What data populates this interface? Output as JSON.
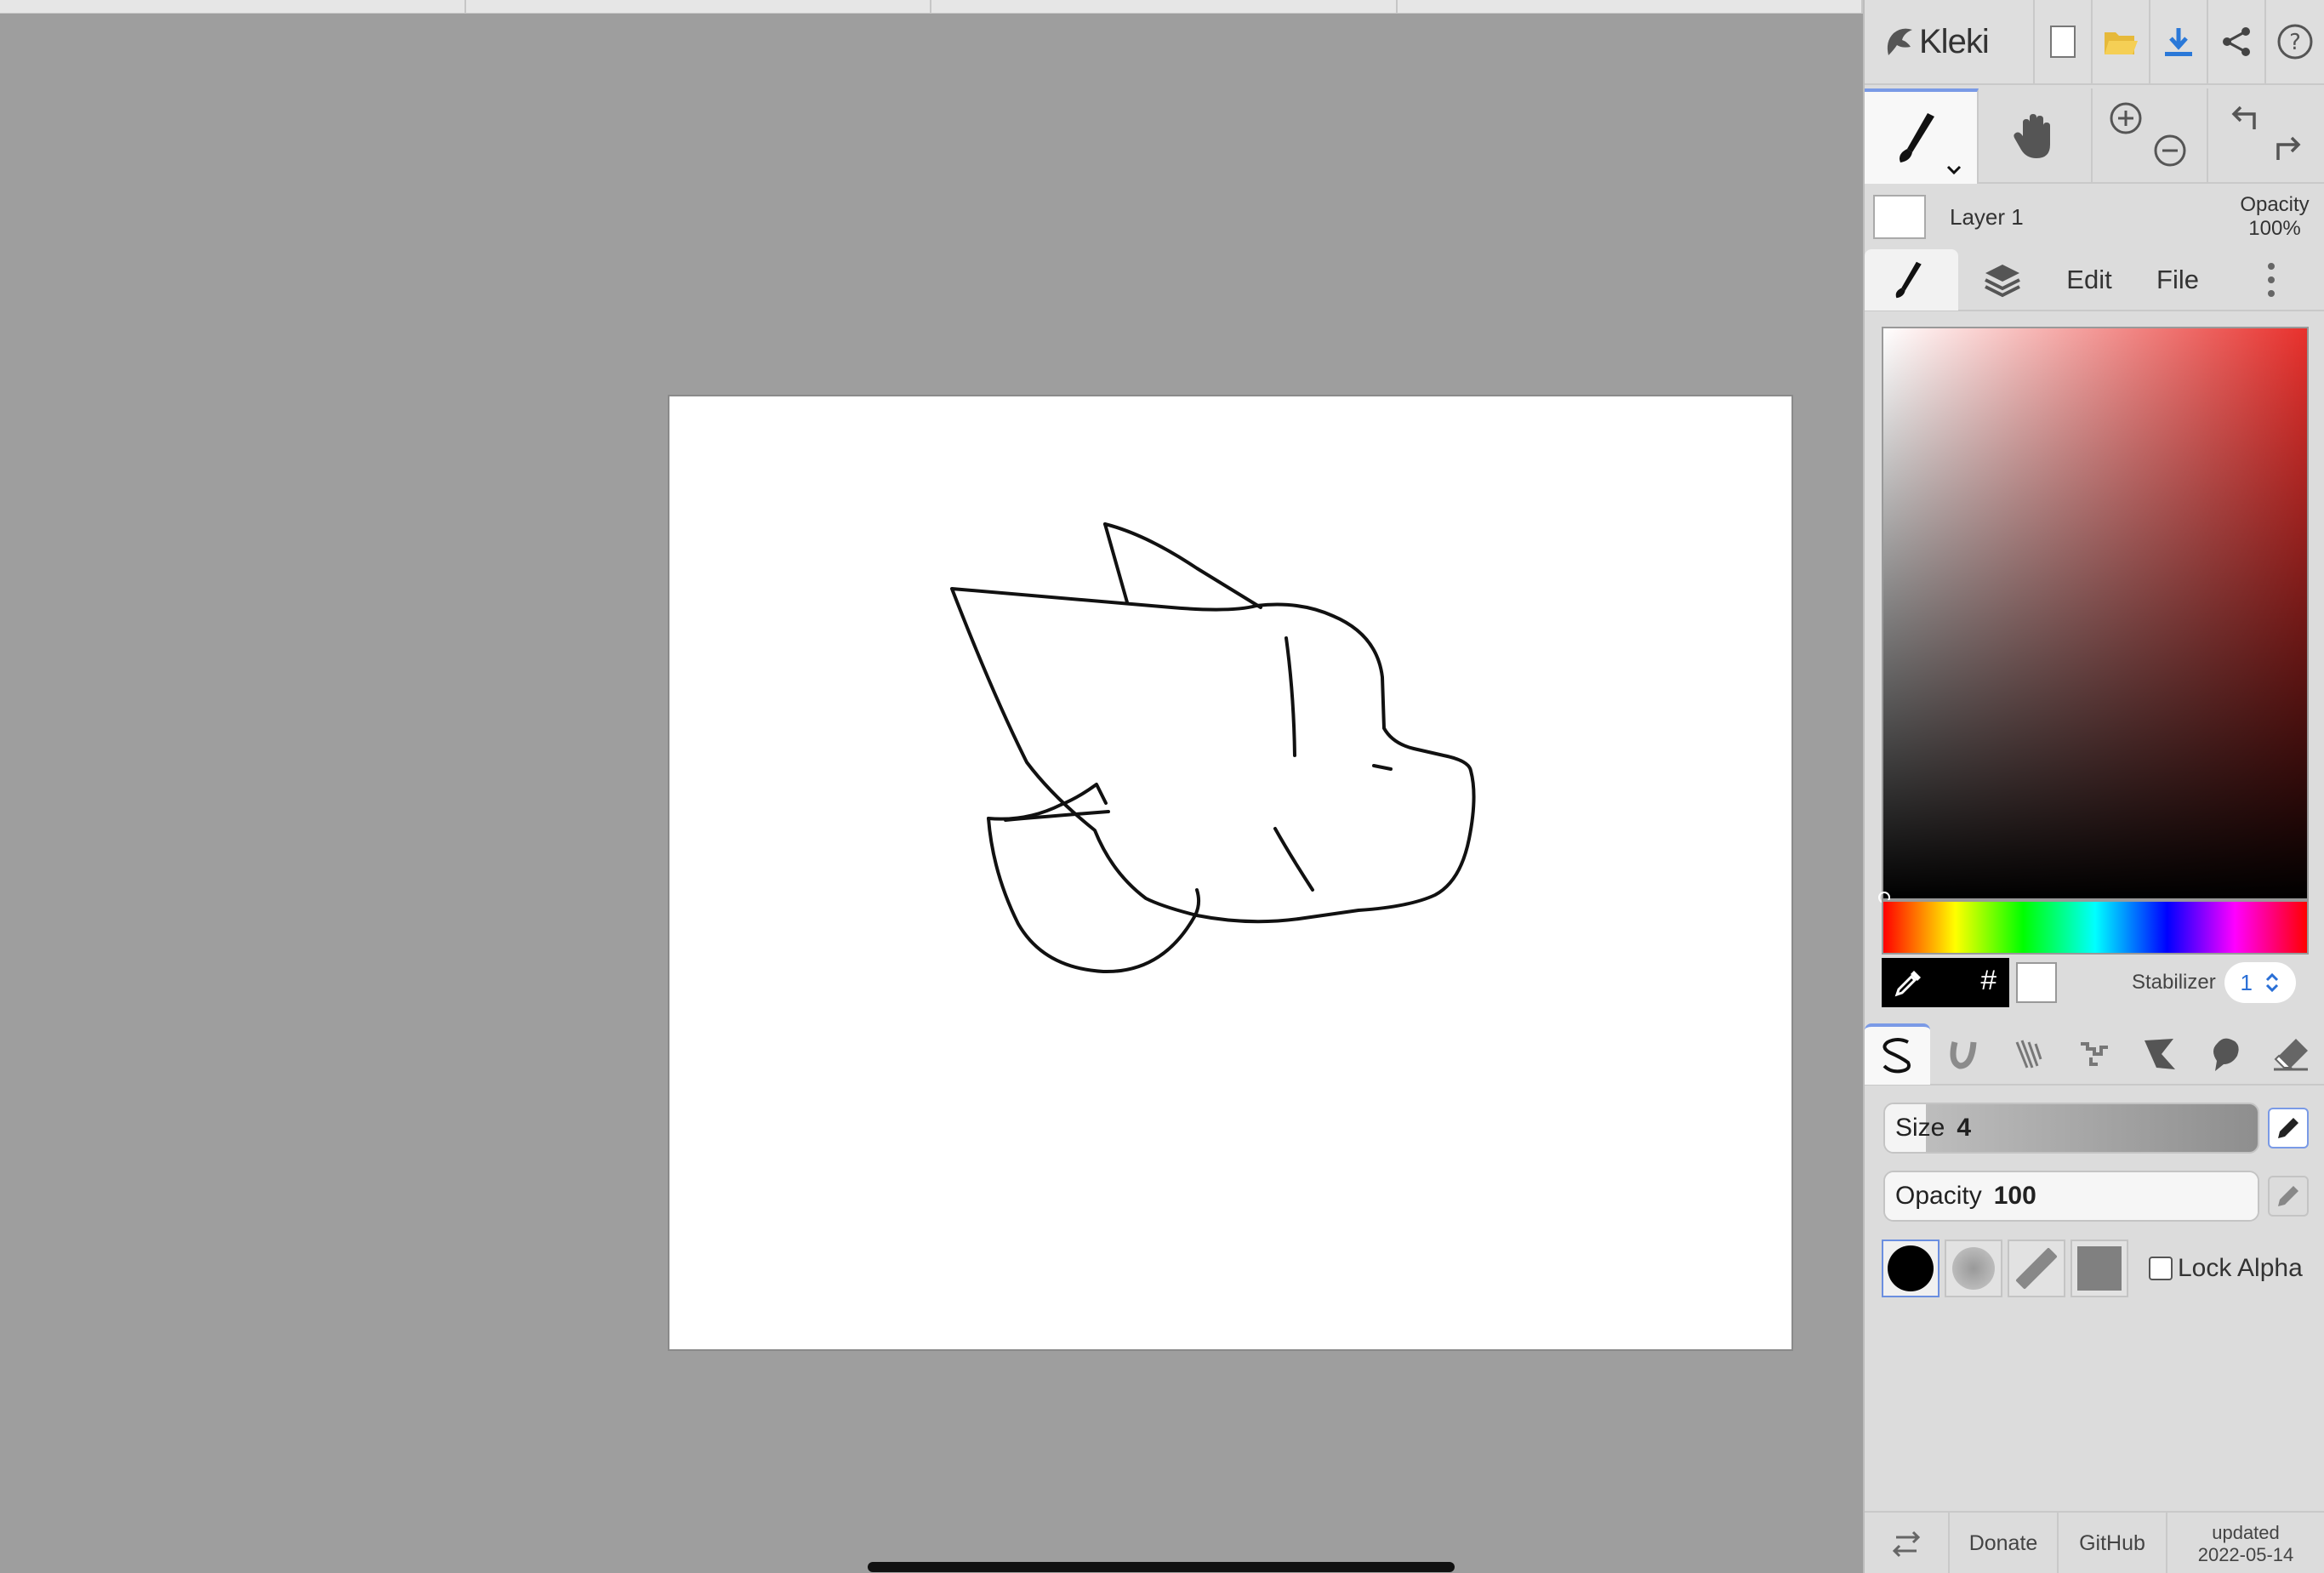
{
  "app": {
    "name": "Kleki"
  },
  "layer": {
    "name": "Layer 1",
    "opacity_label": "Opacity",
    "opacity_value": "100%"
  },
  "tabs": {
    "edit": "Edit",
    "file": "File"
  },
  "color": {
    "hash_label": "#",
    "stabilizer_label": "Stabilizer",
    "stabilizer_value": "1",
    "primary": "#000000",
    "secondary": "#ffffff",
    "hue_accent": "#e8302c"
  },
  "brush": {
    "size_label": "Size",
    "size_value": "4",
    "size_fraction": 0.11,
    "opacity_label": "Opacity",
    "opacity_value": "100",
    "opacity_fraction": 1.0,
    "lock_alpha_label": "Lock Alpha"
  },
  "footer": {
    "donate": "Donate",
    "github": "GitHub",
    "updated_label": "updated",
    "updated_date": "2022-05-14"
  },
  "icons": [
    "document-icon",
    "folder-icon",
    "download-icon",
    "share-icon",
    "help-icon",
    "brush-icon",
    "hand-icon",
    "zoom-in-icon",
    "zoom-out-icon",
    "undo-icon",
    "redo-icon",
    "layers-icon",
    "more-icon",
    "eyedropper-icon",
    "swap-icon"
  ]
}
